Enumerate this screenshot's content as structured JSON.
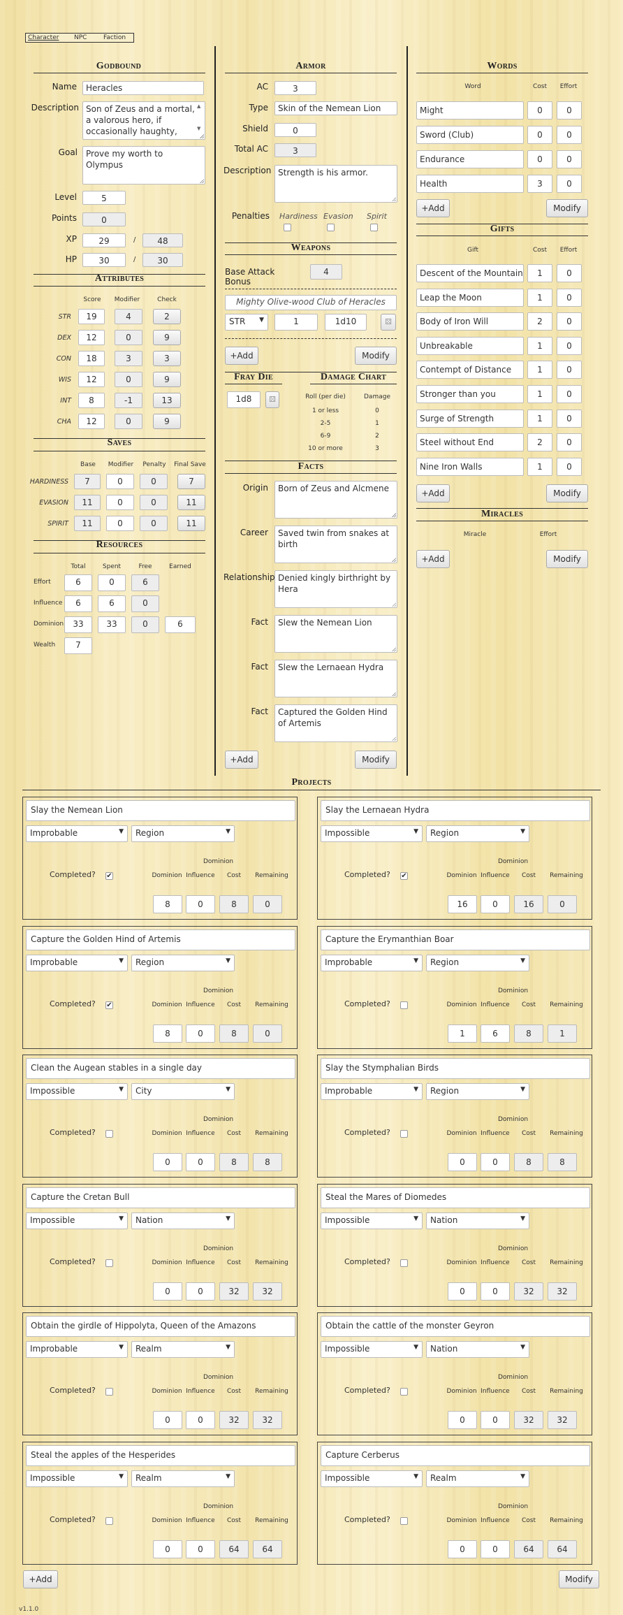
{
  "tabs": [
    "Character",
    "NPC",
    "Faction"
  ],
  "godbound": {
    "heading": "Godbound",
    "name_label": "Name",
    "name": "Heracles",
    "description_label": "Description",
    "description": "Son of Zeus and a mortal, a valorous hero, if occasionally haughty,",
    "goal_label": "Goal",
    "goal": "Prove my worth to Olympus",
    "level_label": "Level",
    "level": "5",
    "points_label": "Points",
    "points": "0",
    "xp_label": "XP",
    "xp": "29",
    "xp_sep": "/",
    "xp_max": "48",
    "hp_label": "HP",
    "hp": "30",
    "hp_sep": "/",
    "hp_max": "30"
  },
  "attributes": {
    "heading": "Attributes",
    "headers": [
      "Score",
      "Modifier",
      "Check"
    ],
    "rows": [
      {
        "name": "STR",
        "score": "19",
        "mod": "4",
        "check": "2"
      },
      {
        "name": "DEX",
        "score": "12",
        "mod": "0",
        "check": "9"
      },
      {
        "name": "CON",
        "score": "18",
        "mod": "3",
        "check": "3"
      },
      {
        "name": "WIS",
        "score": "12",
        "mod": "0",
        "check": "9"
      },
      {
        "name": "INT",
        "score": "8",
        "mod": "-1",
        "check": "13"
      },
      {
        "name": "CHA",
        "score": "12",
        "mod": "0",
        "check": "9"
      }
    ]
  },
  "saves": {
    "heading": "Saves",
    "headers": [
      "Base",
      "Modifier",
      "Penalty",
      "Final Save"
    ],
    "rows": [
      {
        "name": "HARDINESS",
        "base": "7",
        "mod": "0",
        "pen": "0",
        "final": "7"
      },
      {
        "name": "EVASION",
        "base": "11",
        "mod": "0",
        "pen": "0",
        "final": "11"
      },
      {
        "name": "SPIRIT",
        "base": "11",
        "mod": "0",
        "pen": "0",
        "final": "11"
      }
    ]
  },
  "resources": {
    "heading": "Resources",
    "headers": [
      "Total",
      "Spent",
      "Free",
      "Earned"
    ],
    "rows": [
      {
        "name": "Effort",
        "vals": [
          "6",
          "0",
          "6"
        ]
      },
      {
        "name": "Influence",
        "vals": [
          "6",
          "6",
          "0"
        ]
      },
      {
        "name": "Dominion",
        "vals": [
          "33",
          "33",
          "0",
          "6"
        ]
      },
      {
        "name": "Wealth",
        "vals": [
          "7"
        ]
      }
    ]
  },
  "armor": {
    "heading": "Armor",
    "ac_label": "AC",
    "ac": "3",
    "type_label": "Type",
    "type": "Skin of the Nemean Lion",
    "shield_label": "Shield",
    "shield": "0",
    "total_ac_label": "Total AC",
    "total_ac": "3",
    "description_label": "Description",
    "description": "Strength is his armor.",
    "penalties_label": "Penalties",
    "penalty_names": [
      "Hardiness",
      "Evasion",
      "Spirit"
    ]
  },
  "weapons": {
    "heading": "Weapons",
    "bab_label": "Base Attack Bonus",
    "bab": "4",
    "weapon_name": "Mighty Olive-wood Club of Heracles",
    "attr": "STR",
    "bonus": "1",
    "damage": "1d10",
    "add": "+Add",
    "modify": "Modify"
  },
  "fray": {
    "heading": "Fray Die",
    "die": "1d8"
  },
  "damage_chart": {
    "heading": "Damage Chart",
    "headers": [
      "Roll (per die)",
      "Damage"
    ],
    "rows": [
      [
        "1 or less",
        "0"
      ],
      [
        "2-5",
        "1"
      ],
      [
        "6-9",
        "2"
      ],
      [
        "10 or more",
        "3"
      ]
    ]
  },
  "facts": {
    "heading": "Facts",
    "items": [
      {
        "label": "Origin",
        "text": "Born of Zeus and Alcmene"
      },
      {
        "label": "Career",
        "text": "Saved twin from snakes at birth"
      },
      {
        "label": "Relationship",
        "text": "Denied kingly birthright by Hera"
      },
      {
        "label": "Fact",
        "text": "Slew the Nemean Lion"
      },
      {
        "label": "Fact",
        "text": "Slew the Lernaean Hydra"
      },
      {
        "label": "Fact",
        "text": "Captured the Golden Hind of Artemis"
      }
    ],
    "add": "+Add",
    "modify": "Modify"
  },
  "words": {
    "heading": "Words",
    "headers": [
      "Word",
      "Cost",
      "Effort"
    ],
    "rows": [
      [
        "Might",
        "0",
        "0"
      ],
      [
        "Sword (Club)",
        "0",
        "0"
      ],
      [
        "Endurance",
        "0",
        "0"
      ],
      [
        "Health",
        "3",
        "0"
      ]
    ],
    "add": "+Add",
    "modify": "Modify"
  },
  "gifts": {
    "heading": "Gifts",
    "headers": [
      "Gift",
      "Cost",
      "Effort"
    ],
    "rows": [
      [
        "Descent of the Mountain",
        "1",
        "0"
      ],
      [
        "Leap the Moon",
        "1",
        "0"
      ],
      [
        "Body of Iron Will",
        "2",
        "0"
      ],
      [
        "Unbreakable",
        "1",
        "0"
      ],
      [
        "Contempt of Distance",
        "1",
        "0"
      ],
      [
        "Stronger than you",
        "1",
        "0"
      ],
      [
        "Surge of Strength",
        "1",
        "0"
      ],
      [
        "Steel without End",
        "2",
        "0"
      ],
      [
        "Nine Iron Walls",
        "1",
        "0"
      ]
    ],
    "add": "+Add",
    "modify": "Modify"
  },
  "miracles": {
    "heading": "Miracles",
    "headers": [
      "Miracle",
      "Effort"
    ],
    "add": "+Add",
    "modify": "Modify"
  },
  "projects": {
    "heading": "Projects",
    "labels": {
      "completed": "Completed?",
      "dominion_group": "Dominion",
      "dominion": "Dominion",
      "influence": "Influence",
      "cost": "Cost",
      "remaining": "Remaining"
    },
    "items": [
      {
        "title": "Slay the Nemean Lion",
        "difficulty": "Improbable",
        "scope": "Region",
        "completed": true,
        "dominion": "8",
        "influence": "0",
        "cost": "8",
        "remaining": "0"
      },
      {
        "title": "Slay the Lernaean Hydra",
        "difficulty": "Impossible",
        "scope": "Region",
        "completed": true,
        "dominion": "16",
        "influence": "0",
        "cost": "16",
        "remaining": "0"
      },
      {
        "title": "Capture the Golden Hind of Artemis",
        "difficulty": "Improbable",
        "scope": "Region",
        "completed": true,
        "dominion": "8",
        "influence": "0",
        "cost": "8",
        "remaining": "0"
      },
      {
        "title": "Capture the Erymanthian Boar",
        "difficulty": "Improbable",
        "scope": "Region",
        "completed": false,
        "dominion": "1",
        "influence": "6",
        "cost": "8",
        "remaining": "1"
      },
      {
        "title": "Clean the Augean stables in a single day",
        "difficulty": "Impossible",
        "scope": "City",
        "completed": false,
        "dominion": "0",
        "influence": "0",
        "cost": "8",
        "remaining": "8"
      },
      {
        "title": "Slay the Stymphalian Birds",
        "difficulty": "Improbable",
        "scope": "Region",
        "completed": false,
        "dominion": "0",
        "influence": "0",
        "cost": "8",
        "remaining": "8"
      },
      {
        "title": "Capture the Cretan Bull",
        "difficulty": "Impossible",
        "scope": "Nation",
        "completed": false,
        "dominion": "0",
        "influence": "0",
        "cost": "32",
        "remaining": "32"
      },
      {
        "title": "Steal the Mares of Diomedes",
        "difficulty": "Impossible",
        "scope": "Nation",
        "completed": false,
        "dominion": "0",
        "influence": "0",
        "cost": "32",
        "remaining": "32"
      },
      {
        "title": "Obtain the girdle of Hippolyta, Queen of the Amazons",
        "difficulty": "Improbable",
        "scope": "Realm",
        "completed": false,
        "dominion": "0",
        "influence": "0",
        "cost": "32",
        "remaining": "32"
      },
      {
        "title": "Obtain the cattle of the monster Geyron",
        "difficulty": "Impossible",
        "scope": "Nation",
        "completed": false,
        "dominion": "0",
        "influence": "0",
        "cost": "32",
        "remaining": "32"
      },
      {
        "title": "Steal the apples of the Hesperides",
        "difficulty": "Impossible",
        "scope": "Realm",
        "completed": false,
        "dominion": "0",
        "influence": "0",
        "cost": "64",
        "remaining": "64"
      },
      {
        "title": "Capture Cerberus",
        "difficulty": "Impossible",
        "scope": "Realm",
        "completed": false,
        "dominion": "0",
        "influence": "0",
        "cost": "64",
        "remaining": "64"
      }
    ],
    "add": "+Add",
    "modify": "Modify"
  },
  "version": "v1.1.0"
}
